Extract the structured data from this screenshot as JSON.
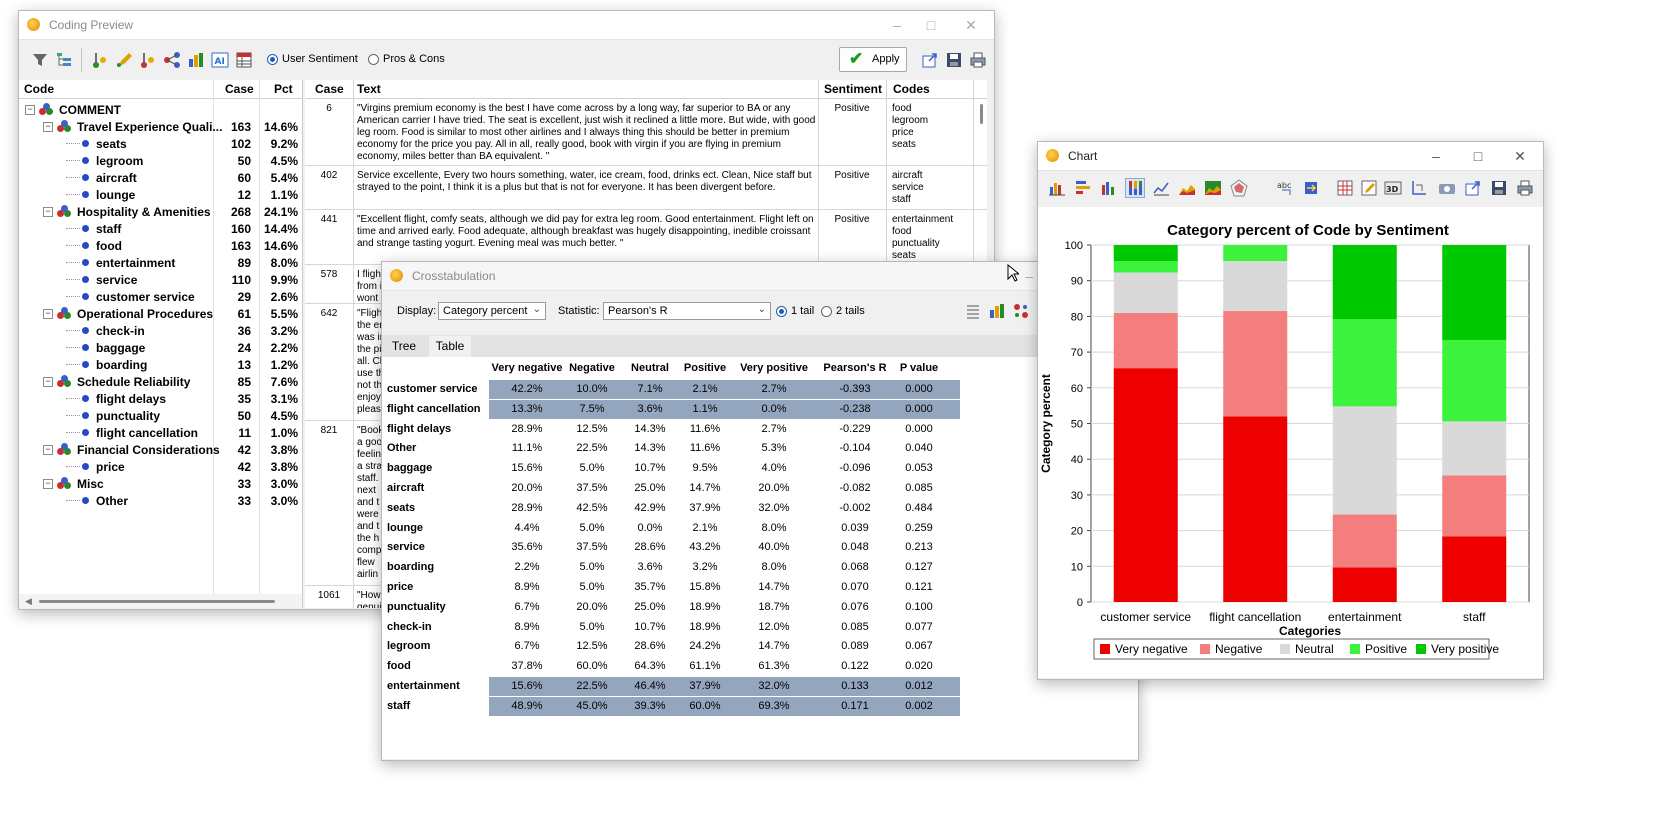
{
  "coding_preview": {
    "title": "Coding Preview",
    "radio_user_sentiment": "User Sentiment",
    "radio_pros_cons": "Pros & Cons",
    "apply_label": "Apply",
    "tree": {
      "headers": {
        "code": "Code",
        "case": "Case",
        "pct": "Pct"
      },
      "rows": [
        {
          "level": 0,
          "name": "COMMENT",
          "case": "",
          "pct": ""
        },
        {
          "level": 1,
          "name": "Travel Experience Quali...",
          "case": "163",
          "pct": "14.6%"
        },
        {
          "level": 2,
          "name": "seats",
          "case": "102",
          "pct": "9.2%"
        },
        {
          "level": 2,
          "name": "legroom",
          "case": "50",
          "pct": "4.5%"
        },
        {
          "level": 2,
          "name": "aircraft",
          "case": "60",
          "pct": "5.4%"
        },
        {
          "level": 2,
          "name": "lounge",
          "case": "12",
          "pct": "1.1%"
        },
        {
          "level": 1,
          "name": "Hospitality & Amenities",
          "case": "268",
          "pct": "24.1%"
        },
        {
          "level": 2,
          "name": "staff",
          "case": "160",
          "pct": "14.4%"
        },
        {
          "level": 2,
          "name": "food",
          "case": "163",
          "pct": "14.6%"
        },
        {
          "level": 2,
          "name": "entertainment",
          "case": "89",
          "pct": "8.0%"
        },
        {
          "level": 2,
          "name": "service",
          "case": "110",
          "pct": "9.9%"
        },
        {
          "level": 2,
          "name": "customer service",
          "case": "29",
          "pct": "2.6%"
        },
        {
          "level": 1,
          "name": "Operational Procedures",
          "case": "61",
          "pct": "5.5%"
        },
        {
          "level": 2,
          "name": "check-in",
          "case": "36",
          "pct": "3.2%"
        },
        {
          "level": 2,
          "name": "baggage",
          "case": "24",
          "pct": "2.2%"
        },
        {
          "level": 2,
          "name": "boarding",
          "case": "13",
          "pct": "1.2%"
        },
        {
          "level": 1,
          "name": "Schedule Reliability",
          "case": "85",
          "pct": "7.6%"
        },
        {
          "level": 2,
          "name": "flight delays",
          "case": "35",
          "pct": "3.1%"
        },
        {
          "level": 2,
          "name": "punctuality",
          "case": "50",
          "pct": "4.5%"
        },
        {
          "level": 2,
          "name": "flight cancellation",
          "case": "11",
          "pct": "1.0%"
        },
        {
          "level": 1,
          "name": "Financial Considerations",
          "case": "42",
          "pct": "3.8%"
        },
        {
          "level": 2,
          "name": "price",
          "case": "42",
          "pct": "3.8%"
        },
        {
          "level": 1,
          "name": "Misc",
          "case": "33",
          "pct": "3.0%"
        },
        {
          "level": 2,
          "name": "Other",
          "case": "33",
          "pct": "3.0%"
        }
      ]
    },
    "text_table": {
      "headers": {
        "case": "Case",
        "text": "Text",
        "sentiment": "Sentiment",
        "codes": "Codes"
      },
      "rows": [
        {
          "case": "6",
          "text": "\"Virgins premium economy is the best I have come across by a long way, far superior to BA or any American carrier I have tried. The seat is excellent, just wish it reclined a little more. But wide, with good leg room.   Food is similar to most other airlines and I always thing this should be better in premium economy for the price you pay.   All in all, really good, book with virgin if you are flying in premium economy, miles better than BA equivalent. \"",
          "sentiment": "Positive",
          "codes": [
            "food",
            "legroom",
            "price",
            "seats"
          ]
        },
        {
          "case": "402",
          "text": "Service excellente, Every two hours something, water, ice cream, food, drinks ect. Clean, Nice staff but strayed to the point, I think it is a plus but that is not for everyone. It has been divergent before.",
          "sentiment": "Positive",
          "codes": [
            "aircraft",
            "service",
            "staff"
          ]
        },
        {
          "case": "441",
          "text": "\"Excellent flight, comfy seats, although we did pay for extra leg room. Good entertainment. Flight left on time and arrived early. Food adequate, although breakfast was hugely disappointing, inedible croissant and strange tasting yogurt. Evening meal was much better. \"",
          "sentiment": "Positive",
          "codes": [
            "entertainment",
            "food",
            "punctuality",
            "seats"
          ]
        },
        {
          "case": "578",
          "text": "I fligh\nfrom i\nwont",
          "sentiment": "",
          "codes": []
        },
        {
          "case": "642",
          "text": "\"Fligh\nthe en\nwas ir\nthe pi\nall. Cl\nuse th\nnot th\nenjoy\npleas",
          "sentiment": "",
          "codes": []
        },
        {
          "case": "821",
          "text": "\"Book\na goo\nfeelin\na stra\nstaff.\nnext\nand t\nwere\nand t\nthe h\ncomp\nflew\nairlin",
          "sentiment": "",
          "codes": []
        },
        {
          "case": "1061",
          "text": "\"How\ngenui",
          "sentiment": "",
          "codes": []
        }
      ]
    }
  },
  "crosstab": {
    "title": "Crosstabulation",
    "display_label": "Display:",
    "display_value": "Category percent",
    "statistic_label": "Statistic:",
    "statistic_value": "Pearson's R",
    "tail1": "1 tail",
    "tail2": "2 tails",
    "tab_tree": "Tree",
    "tab_table": "Table",
    "columns": [
      "Very negative",
      "Negative",
      "Neutral",
      "Positive",
      "Very positive",
      "Pearson's R",
      "P value"
    ],
    "rows": [
      {
        "label": "customer service",
        "values": [
          "42.2%",
          "10.0%",
          "7.1%",
          "2.1%",
          "2.7%",
          "-0.393",
          "0.000"
        ],
        "highlight": true
      },
      {
        "label": "flight cancellation",
        "values": [
          "13.3%",
          "7.5%",
          "3.6%",
          "1.1%",
          "0.0%",
          "-0.238",
          "0.000"
        ],
        "highlight": true
      },
      {
        "label": "flight delays",
        "values": [
          "28.9%",
          "12.5%",
          "14.3%",
          "11.6%",
          "2.7%",
          "-0.229",
          "0.000"
        ],
        "highlight": false
      },
      {
        "label": "Other",
        "values": [
          "11.1%",
          "22.5%",
          "14.3%",
          "11.6%",
          "5.3%",
          "-0.104",
          "0.040"
        ],
        "highlight": false
      },
      {
        "label": "baggage",
        "values": [
          "15.6%",
          "5.0%",
          "10.7%",
          "9.5%",
          "4.0%",
          "-0.096",
          "0.053"
        ],
        "highlight": false
      },
      {
        "label": "aircraft",
        "values": [
          "20.0%",
          "37.5%",
          "25.0%",
          "14.7%",
          "20.0%",
          "-0.082",
          "0.085"
        ],
        "highlight": false
      },
      {
        "label": "seats",
        "values": [
          "28.9%",
          "42.5%",
          "42.9%",
          "37.9%",
          "32.0%",
          "-0.002",
          "0.484"
        ],
        "highlight": false
      },
      {
        "label": "lounge",
        "values": [
          "4.4%",
          "5.0%",
          "0.0%",
          "2.1%",
          "8.0%",
          "0.039",
          "0.259"
        ],
        "highlight": false
      },
      {
        "label": "service",
        "values": [
          "35.6%",
          "37.5%",
          "28.6%",
          "43.2%",
          "40.0%",
          "0.048",
          "0.213"
        ],
        "highlight": false
      },
      {
        "label": "boarding",
        "values": [
          "2.2%",
          "5.0%",
          "3.6%",
          "3.2%",
          "8.0%",
          "0.068",
          "0.127"
        ],
        "highlight": false
      },
      {
        "label": "price",
        "values": [
          "8.9%",
          "5.0%",
          "35.7%",
          "15.8%",
          "14.7%",
          "0.070",
          "0.121"
        ],
        "highlight": false
      },
      {
        "label": "punctuality",
        "values": [
          "6.7%",
          "20.0%",
          "25.0%",
          "18.9%",
          "18.7%",
          "0.076",
          "0.100"
        ],
        "highlight": false
      },
      {
        "label": "check-in",
        "values": [
          "8.9%",
          "5.0%",
          "10.7%",
          "18.9%",
          "12.0%",
          "0.085",
          "0.077"
        ],
        "highlight": false
      },
      {
        "label": "legroom",
        "values": [
          "6.7%",
          "12.5%",
          "28.6%",
          "24.2%",
          "14.7%",
          "0.089",
          "0.067"
        ],
        "highlight": false
      },
      {
        "label": "food",
        "values": [
          "37.8%",
          "60.0%",
          "64.3%",
          "61.1%",
          "61.3%",
          "0.122",
          "0.020"
        ],
        "highlight": false
      },
      {
        "label": "entertainment",
        "values": [
          "15.6%",
          "22.5%",
          "46.4%",
          "37.9%",
          "32.0%",
          "0.133",
          "0.012"
        ],
        "highlight": true
      },
      {
        "label": "staff",
        "values": [
          "48.9%",
          "45.0%",
          "39.3%",
          "60.0%",
          "69.3%",
          "0.171",
          "0.002"
        ],
        "highlight": true
      }
    ]
  },
  "chart_window": {
    "title": "Chart"
  },
  "chart_data": {
    "type": "bar",
    "stacked": true,
    "title": "Category percent of Code  by Sentiment",
    "xlabel": "Categories",
    "ylabel": "Category percent",
    "ylim": [
      0,
      100
    ],
    "yticks": [
      0,
      10,
      20,
      30,
      40,
      50,
      60,
      70,
      80,
      90,
      100
    ],
    "categories": [
      "customer service",
      "flight cancellation",
      "entertainment",
      "staff"
    ],
    "series": [
      {
        "name": "Very negative",
        "color": "#ee0000",
        "values": [
          65.5,
          52.0,
          9.7,
          18.4
        ]
      },
      {
        "name": "Negative",
        "color": "#f47d7d",
        "values": [
          15.5,
          29.5,
          14.8,
          17.1
        ]
      },
      {
        "name": "Neutral",
        "color": "#d9d9d9",
        "values": [
          11.3,
          14.0,
          30.3,
          15.1
        ]
      },
      {
        "name": "Positive",
        "color": "#3df23d",
        "values": [
          3.2,
          4.5,
          24.4,
          22.8
        ]
      },
      {
        "name": "Very positive",
        "color": "#00c800",
        "values": [
          4.5,
          0.0,
          20.8,
          26.6
        ]
      }
    ],
    "grid": "horizontal",
    "legend_position": "bottom"
  }
}
